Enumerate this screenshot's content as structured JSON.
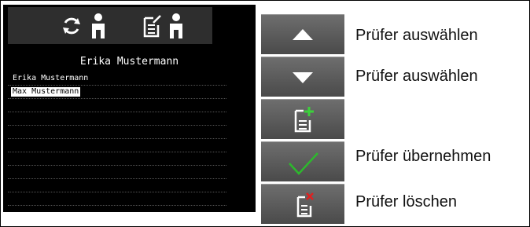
{
  "header": {
    "icons": [
      "refresh-icon",
      "person-icon",
      "edit-document-icon",
      "person-icon"
    ]
  },
  "selected_tester": "Erika Mustermann",
  "testers": [
    {
      "name": "Erika Mustermann",
      "selected": false
    },
    {
      "name": "Max Mustermann",
      "selected": true
    },
    {
      "name": "",
      "selected": false
    },
    {
      "name": "",
      "selected": false
    },
    {
      "name": "",
      "selected": false
    },
    {
      "name": "",
      "selected": false
    },
    {
      "name": "",
      "selected": false
    },
    {
      "name": "",
      "selected": false
    },
    {
      "name": "",
      "selected": false
    },
    {
      "name": "",
      "selected": false
    }
  ],
  "buttons": [
    {
      "icon": "arrow-up-icon",
      "label": "Prüfer auswählen"
    },
    {
      "icon": "arrow-down-icon",
      "label": "Prüfer auswählen"
    },
    {
      "icon": "add-document-icon",
      "label": ""
    },
    {
      "icon": "checkmark-icon",
      "label": "Prüfer übernehmen"
    },
    {
      "icon": "delete-document-icon",
      "label": "Prüfer löschen"
    }
  ],
  "colors": {
    "screen_bg": "#000000",
    "header_bg": "#2e2e2e",
    "button_bg": "#5a5a5a",
    "add_green": "#3bd13b",
    "check_green": "#2db82d",
    "delete_red": "#e02020"
  }
}
